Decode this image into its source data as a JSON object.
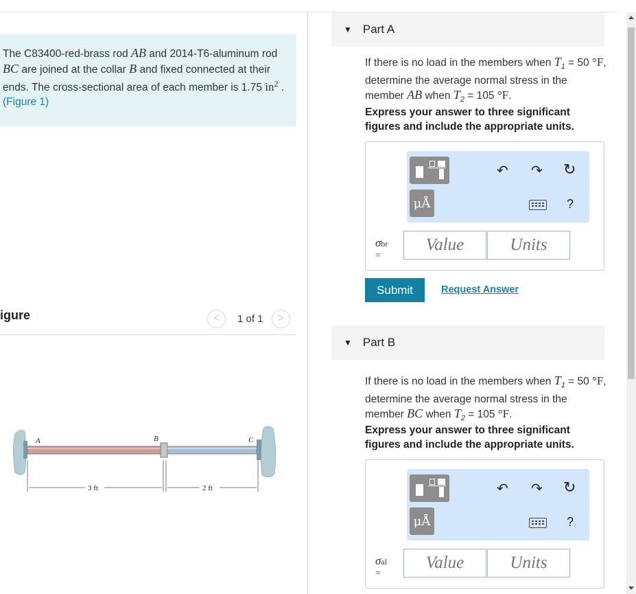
{
  "problem": {
    "text1": "The C83400-red-brass rod ",
    "rod1": "AB",
    "text2": " and 2014-T6-aluminum rod ",
    "rod2": "BC",
    "text3": " are joined at the collar ",
    "collar": "B",
    "text4": " and fixed connected at their ends. The cross-sectional area of each member is 1.75 ",
    "area_unit": "in",
    "area_exp": "2",
    "text5": " .",
    "figure_link": "(Figure 1)"
  },
  "figure": {
    "heading": "igure",
    "pager_text": "1 of 1",
    "prev": "<",
    "next": ">",
    "label_a": "A",
    "label_b": "B",
    "label_c": "C",
    "dim_ab": "3 ft",
    "dim_bc": "2 ft",
    "colors": {
      "brass": "#c9a198",
      "aluminum": "#a9c0cc",
      "wall": "#b3cfd5"
    }
  },
  "parts": [
    {
      "label": "Part A",
      "q_prefix": "If there is no load in the members when ",
      "t1": "T",
      "t1_sub": "1",
      "t1_val": " = 50 ",
      "deg1": "°F",
      "q_mid": ", determine the average normal stress in the member ",
      "member": "AB",
      "q_when": " when ",
      "t2": "T",
      "t2_sub": "2",
      "t2_val": " = 105 ",
      "deg2": "°F",
      "q_end": ".",
      "instruction": "Express your answer to three significant figures and include the appropriate units.",
      "symbol": "σ",
      "symbol_sub": "br",
      "equals": "=",
      "value_placeholder": "Value",
      "units_placeholder": "Units",
      "submit": "Submit",
      "request": "Request Answer"
    },
    {
      "label": "Part B",
      "q_prefix": "If there is no load in the members when ",
      "t1": "T",
      "t1_sub": "1",
      "t1_val": " = 50 ",
      "deg1": "°F",
      "q_mid": ", determine the average normal stress in the member ",
      "member": "BC",
      "q_when": " when ",
      "t2": "T",
      "t2_sub": "2",
      "t2_val": " = 105 ",
      "deg2": "°F",
      "q_end": ".",
      "instruction": "Express your answer to three significant figures and include the appropriate units.",
      "symbol": "σ",
      "symbol_sub": "al",
      "equals": "=",
      "value_placeholder": "Value",
      "units_placeholder": "Units"
    }
  ],
  "toolbar": {
    "mu_label": "μÅ",
    "undo_icon": "↶",
    "redo_icon": "↷",
    "reset_icon": "↻",
    "help_label": "?"
  },
  "colors": {
    "accent": "#147fa0",
    "link": "#1f7fa0",
    "toolbar_bg": "#d3e6fc",
    "problem_bg": "#e4f4f6"
  }
}
